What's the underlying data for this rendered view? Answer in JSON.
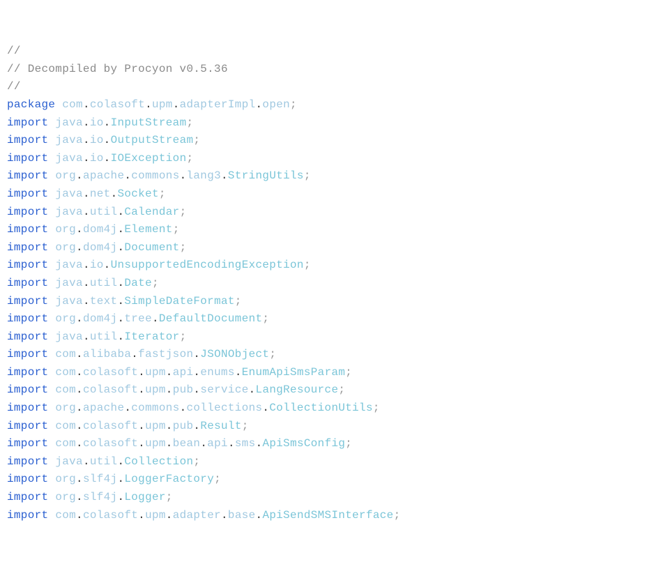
{
  "comments": {
    "c1": "// ",
    "c2": "// Decompiled by Procyon v0.5.36",
    "c3": "// "
  },
  "pkg": {
    "kw": "package",
    "p1": "com",
    "p2": "colasoft",
    "p3": "upm",
    "p4": "adapterImpl",
    "p5": "open"
  },
  "kw": {
    "import": "import"
  },
  "dot": ".",
  "semi": ";",
  "imports": [
    {
      "parts": [
        "java",
        "io"
      ],
      "type": "InputStream"
    },
    {
      "parts": [
        "java",
        "io"
      ],
      "type": "OutputStream"
    },
    {
      "parts": [
        "java",
        "io"
      ],
      "type": "IOException"
    },
    {
      "parts": [
        "org",
        "apache",
        "commons",
        "lang3"
      ],
      "type": "StringUtils"
    },
    {
      "parts": [
        "java",
        "net"
      ],
      "type": "Socket"
    },
    {
      "parts": [
        "java",
        "util"
      ],
      "type": "Calendar"
    },
    {
      "parts": [
        "org",
        "dom4j"
      ],
      "type": "Element"
    },
    {
      "parts": [
        "org",
        "dom4j"
      ],
      "type": "Document"
    },
    {
      "parts": [
        "java",
        "io"
      ],
      "type": "UnsupportedEncodingException"
    },
    {
      "parts": [
        "java",
        "util"
      ],
      "type": "Date"
    },
    {
      "parts": [
        "java",
        "text"
      ],
      "type": "SimpleDateFormat"
    },
    {
      "parts": [
        "org",
        "dom4j",
        "tree"
      ],
      "type": "DefaultDocument"
    },
    {
      "parts": [
        "java",
        "util"
      ],
      "type": "Iterator"
    },
    {
      "parts": [
        "com",
        "alibaba",
        "fastjson"
      ],
      "type": "JSONObject"
    },
    {
      "parts": [
        "com",
        "colasoft",
        "upm",
        "api",
        "enums"
      ],
      "type": "EnumApiSmsParam"
    },
    {
      "parts": [
        "com",
        "colasoft",
        "upm",
        "pub",
        "service"
      ],
      "type": "LangResource"
    },
    {
      "parts": [
        "org",
        "apache",
        "commons",
        "collections"
      ],
      "type": "CollectionUtils"
    },
    {
      "parts": [
        "com",
        "colasoft",
        "upm",
        "pub"
      ],
      "type": "Result"
    },
    {
      "parts": [
        "com",
        "colasoft",
        "upm",
        "bean",
        "api",
        "sms"
      ],
      "type": "ApiSmsConfig"
    },
    {
      "parts": [
        "java",
        "util"
      ],
      "type": "Collection"
    },
    {
      "parts": [
        "org",
        "slf4j"
      ],
      "type": "LoggerFactory"
    },
    {
      "parts": [
        "org",
        "slf4j"
      ],
      "type": "Logger"
    },
    {
      "parts": [
        "com",
        "colasoft",
        "upm",
        "adapter",
        "base"
      ],
      "type": "ApiSendSMSInterface"
    }
  ]
}
